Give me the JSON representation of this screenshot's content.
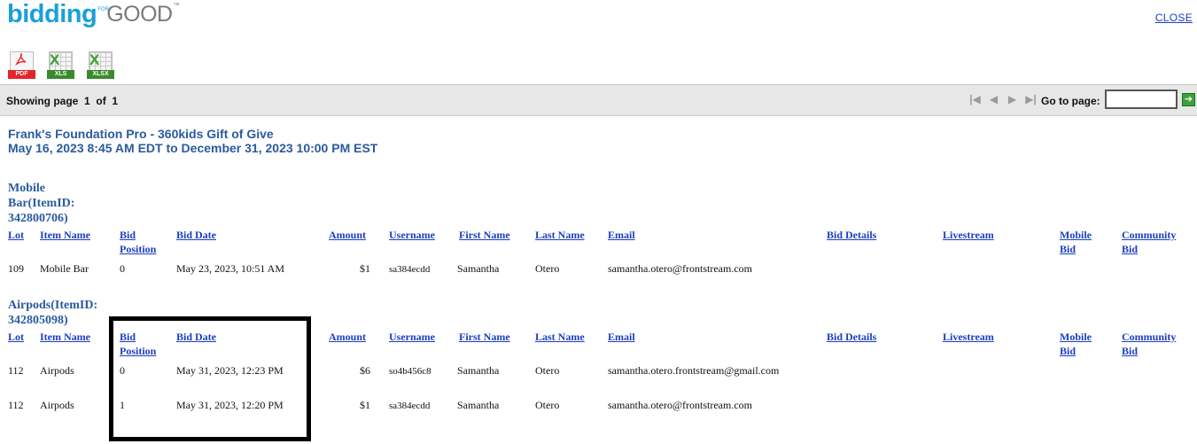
{
  "logo": {
    "bidding": "bidding",
    "for": "FOR",
    "good": "GOOD",
    "tm": "™"
  },
  "header": {
    "close_label": "CLOSE"
  },
  "export": [
    {
      "badge": "PDF",
      "icon": "pdf-file-icon",
      "color": "#e3252a"
    },
    {
      "badge": "XLS",
      "icon": "xls-file-icon",
      "color": "#3a8a2c"
    },
    {
      "badge": "XLSX",
      "icon": "xlsx-file-icon",
      "color": "#3a8a2c"
    }
  ],
  "pager": {
    "showing_prefix": "Showing page",
    "current_page": "1",
    "of_label": "of",
    "total_pages": "1",
    "goto_label": "Go to page:",
    "goto_value": "",
    "nav_icons": [
      "first-page-icon",
      "previous-page-icon",
      "next-page-icon",
      "last-page-icon"
    ]
  },
  "report": {
    "title": "Frank's Foundation Pro - 360kids Gift of Give",
    "date_range": "May 16, 2023 8:45 AM EDT to December 31, 2023 10:00 PM EST"
  },
  "columns": {
    "lot": "Lot",
    "item_name": "Item Name",
    "bid_position_1": "Bid",
    "bid_position_2": "Position",
    "bid_date": "Bid Date",
    "amount": "Amount",
    "username": "Username",
    "first_name": "First Name",
    "last_name": "Last Name",
    "email": "Email",
    "bid_details": "Bid Details",
    "livestream": "Livestream",
    "mobile_bid_1": "Mobile",
    "mobile_bid_2": "Bid",
    "community_bid_1": "Community",
    "community_bid_2": "Bid"
  },
  "sections": [
    {
      "title_lines": [
        "Mobile",
        "Bar(ItemID:",
        "342800706)"
      ],
      "rows": [
        {
          "lot": "109",
          "item_name": "Mobile Bar",
          "bid_position": "0",
          "bid_date": "May 23, 2023, 10:51 AM",
          "amount": "$1",
          "username": "sa384ecdd",
          "first_name": "Samantha",
          "last_name": "Otero",
          "email": "samantha.otero@frontstream.com"
        }
      ]
    },
    {
      "title_lines": [
        "Airpods(ItemID:",
        "342805098)"
      ],
      "rows": [
        {
          "lot": "112",
          "item_name": "Airpods",
          "bid_position": "0",
          "bid_date": "May 31, 2023, 12:23 PM",
          "amount": "$6",
          "username": "so4b456c8",
          "first_name": "Samantha",
          "last_name": "Otero",
          "email": "samantha.otero.frontstream@gmail.com"
        },
        {
          "lot": "112",
          "item_name": "Airpods",
          "bid_position": "1",
          "bid_date": "May 31, 2023, 12:20 PM",
          "amount": "$1",
          "username": "sa384ecdd",
          "first_name": "Samantha",
          "last_name": "Otero",
          "email": "samantha.otero@frontstream.com"
        }
      ]
    }
  ]
}
